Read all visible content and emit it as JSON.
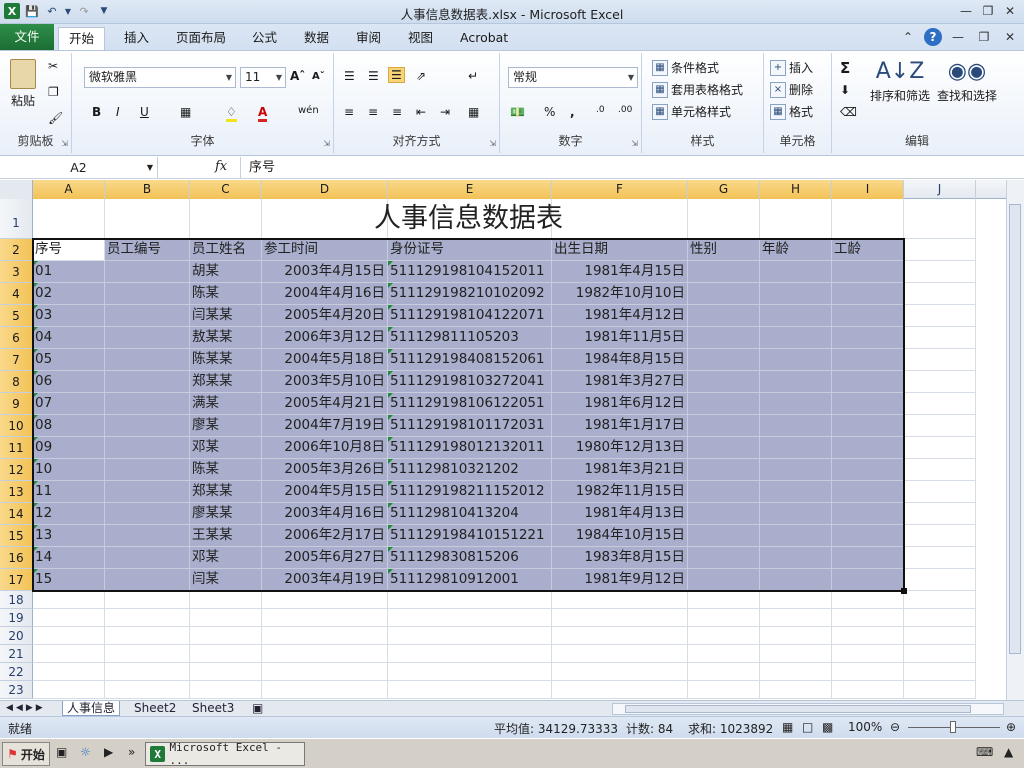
{
  "window": {
    "title": "人事信息数据表.xlsx - Microsoft Excel"
  },
  "ribbon_tabs": [
    "文件",
    "开始",
    "插入",
    "页面布局",
    "公式",
    "数据",
    "审阅",
    "视图",
    "Acrobat"
  ],
  "ribbon": {
    "clipboard": {
      "paste": "粘贴",
      "label": "剪贴板"
    },
    "font": {
      "name": "微软雅黑",
      "size": "11",
      "label": "字体"
    },
    "alignment": {
      "label": "对齐方式"
    },
    "number": {
      "format": "常规",
      "label": "数字"
    },
    "styles": {
      "conditional": "条件格式",
      "table": "套用表格格式",
      "cell": "单元格样式",
      "label": "样式"
    },
    "cells": {
      "insert": "插入",
      "delete": "删除",
      "format": "格式",
      "label": "单元格"
    },
    "editing": {
      "sort": "排序和筛选",
      "find": "查找和选择",
      "label": "编辑"
    }
  },
  "formula_bar": {
    "name_box": "A2",
    "fx": "fx",
    "content": "序号"
  },
  "columns": [
    "A",
    "B",
    "C",
    "D",
    "E",
    "F",
    "G",
    "H",
    "I",
    "J"
  ],
  "rows": [
    "1",
    "2",
    "3",
    "4",
    "5",
    "6",
    "7",
    "8",
    "9",
    "10",
    "11",
    "12",
    "13",
    "14",
    "15",
    "16",
    "17",
    "18",
    "19",
    "20",
    "21",
    "22",
    "23"
  ],
  "sheet": {
    "title": "人事信息数据表",
    "headers": [
      "序号",
      "员工编号",
      "员工姓名",
      "参工时间",
      "身份证号",
      "出生日期",
      "性别",
      "年龄",
      "工龄"
    ],
    "records": [
      [
        "01",
        "",
        "胡某",
        "2003年4月15日",
        "511129198104152011",
        "1981年4月15日"
      ],
      [
        "02",
        "",
        "陈某",
        "2004年4月16日",
        "511129198210102092",
        "1982年10月10日"
      ],
      [
        "03",
        "",
        "闫某某",
        "2005年4月20日",
        "511129198104122071",
        "1981年4月12日"
      ],
      [
        "04",
        "",
        "敖某某",
        "2006年3月12日",
        "511129811105203",
        "1981年11月5日"
      ],
      [
        "05",
        "",
        "陈某某",
        "2004年5月18日",
        "511129198408152061",
        "1984年8月15日"
      ],
      [
        "06",
        "",
        "郑某某",
        "2003年5月10日",
        "511129198103272041",
        "1981年3月27日"
      ],
      [
        "07",
        "",
        "满某",
        "2005年4月21日",
        "511129198106122051",
        "1981年6月12日"
      ],
      [
        "08",
        "",
        "廖某",
        "2004年7月19日",
        "511129198101172031",
        "1981年1月17日"
      ],
      [
        "09",
        "",
        "邓某",
        "2006年10月8日",
        "511129198012132011",
        "1980年12月13日"
      ],
      [
        "10",
        "",
        "陈某",
        "2005年3月26日",
        "511129810321202",
        "1981年3月21日"
      ],
      [
        "11",
        "",
        "郑某某",
        "2004年5月15日",
        "511129198211152012",
        "1982年11月15日"
      ],
      [
        "12",
        "",
        "廖某某",
        "2003年4月16日",
        "511129810413204",
        "1981年4月13日"
      ],
      [
        "13",
        "",
        "王某某",
        "2006年2月17日",
        "511129198410151221",
        "1984年10月15日"
      ],
      [
        "14",
        "",
        "邓某",
        "2005年6月27日",
        "511129830815206",
        "1983年8月15日"
      ],
      [
        "15",
        "",
        "闫某",
        "2003年4月19日",
        "511129810912001",
        "1981年9月12日"
      ]
    ]
  },
  "sheet_tabs": [
    "人事信息",
    "Sheet2",
    "Sheet3"
  ],
  "status": {
    "ready": "就绪",
    "average": "平均值: 34129.73333",
    "count": "计数: 84",
    "sum": "求和: 1023892",
    "zoom": "100%"
  },
  "taskbar": {
    "start": "开始",
    "excel": "Microsoft Excel - ..."
  },
  "colors": {
    "selection": "#a8aecb",
    "file_tab": "#1b6e33",
    "header_highlight": "#f2c257"
  }
}
